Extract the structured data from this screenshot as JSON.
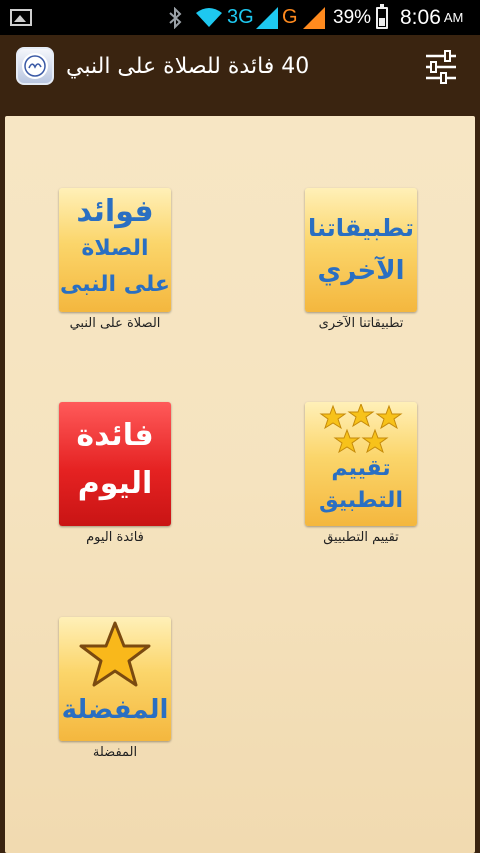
{
  "status_bar": {
    "network_3g": "3G",
    "network_g": "G",
    "battery": "39%",
    "time": "8:06",
    "ampm": "AM"
  },
  "action_bar": {
    "title": "40 فائدة للصلاة على النبي",
    "icons": [
      "app-logo-icon",
      "settings-sliders-icon"
    ]
  },
  "colors": {
    "actionbar_bg": "#3a2410",
    "content_bg": "#f5e3bf",
    "gold_tile": "#f4b73e",
    "red_tile": "#e52222",
    "tile_text_blue": "#2a6fc2",
    "tile_text_white": "#ffffff"
  },
  "tiles": [
    {
      "label": "الصلاة على النبي",
      "image_lines": [
        "فوائد",
        "الصلاة",
        "على النبى"
      ],
      "icon": "benefits-icon"
    },
    {
      "label": "تطبيقاتنا الآخرى",
      "image_lines": [
        "تطبيقاتنا",
        "الآخري"
      ],
      "icon": "other-apps-icon"
    },
    {
      "label": "فائدة اليوم",
      "image_lines": [
        "فائدة",
        "اليوم"
      ],
      "icon": "daily-benefit-icon"
    },
    {
      "label": "تقييم التطبييق",
      "image_lines": [
        "تقييم",
        "التطبيق"
      ],
      "icon": "rate-app-icon"
    },
    {
      "label": "المفضلة",
      "image_lines": [
        "المفضلة"
      ],
      "icon": "favorites-icon"
    }
  ]
}
